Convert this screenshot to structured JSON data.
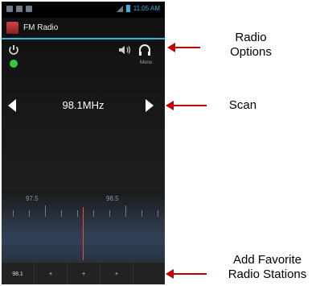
{
  "status_bar": {
    "time": "11:05 AM"
  },
  "app": {
    "title": "FM Radio"
  },
  "radio": {
    "mode": "Mono",
    "frequency": "98.1MHz",
    "dial_labels": [
      "97.5",
      "98.5"
    ]
  },
  "favorites": [
    "98.1",
    "+",
    "+",
    "+"
  ],
  "annotations": {
    "radio_options": "Radio\nOptions",
    "scan": "Scan",
    "favorites": "Add Favorite\nRadio Stations"
  },
  "colors": {
    "accent": "#33b5e5",
    "arrow": "#c00000",
    "power_led": "#2ecc40",
    "needle": "#ff4a2a"
  }
}
